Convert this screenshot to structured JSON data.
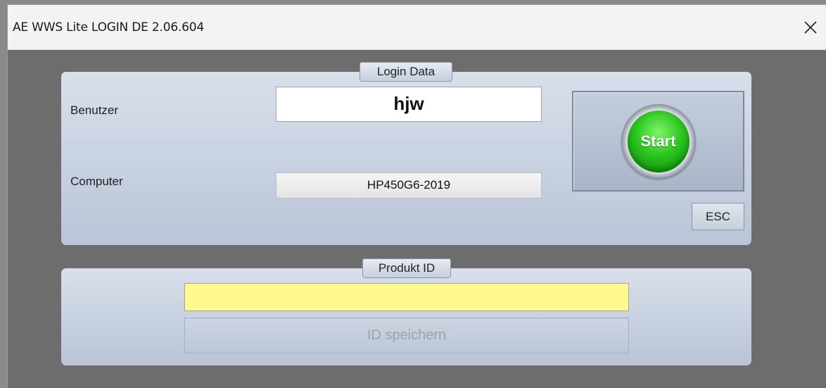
{
  "window": {
    "title": "AE WWS Lite LOGIN DE 2.06.604"
  },
  "login_panel": {
    "caption": "Login Data",
    "user_label": "Benutzer",
    "user_value": "hjw",
    "computer_label": "Computer",
    "computer_value": "HP450G6-2019",
    "start_label": "Start",
    "esc_label": "ESC"
  },
  "product_panel": {
    "caption": "Produkt ID",
    "product_id_value": "",
    "save_label": "ID speichern",
    "save_enabled": false
  },
  "colors": {
    "product_input_bg": "#fff98f",
    "start_green": "#2dc61f",
    "panel_top": "#d9e0ec",
    "panel_bottom": "#b9c4d6"
  },
  "icons": {
    "close": "close-icon",
    "start": "start-button-icon"
  }
}
